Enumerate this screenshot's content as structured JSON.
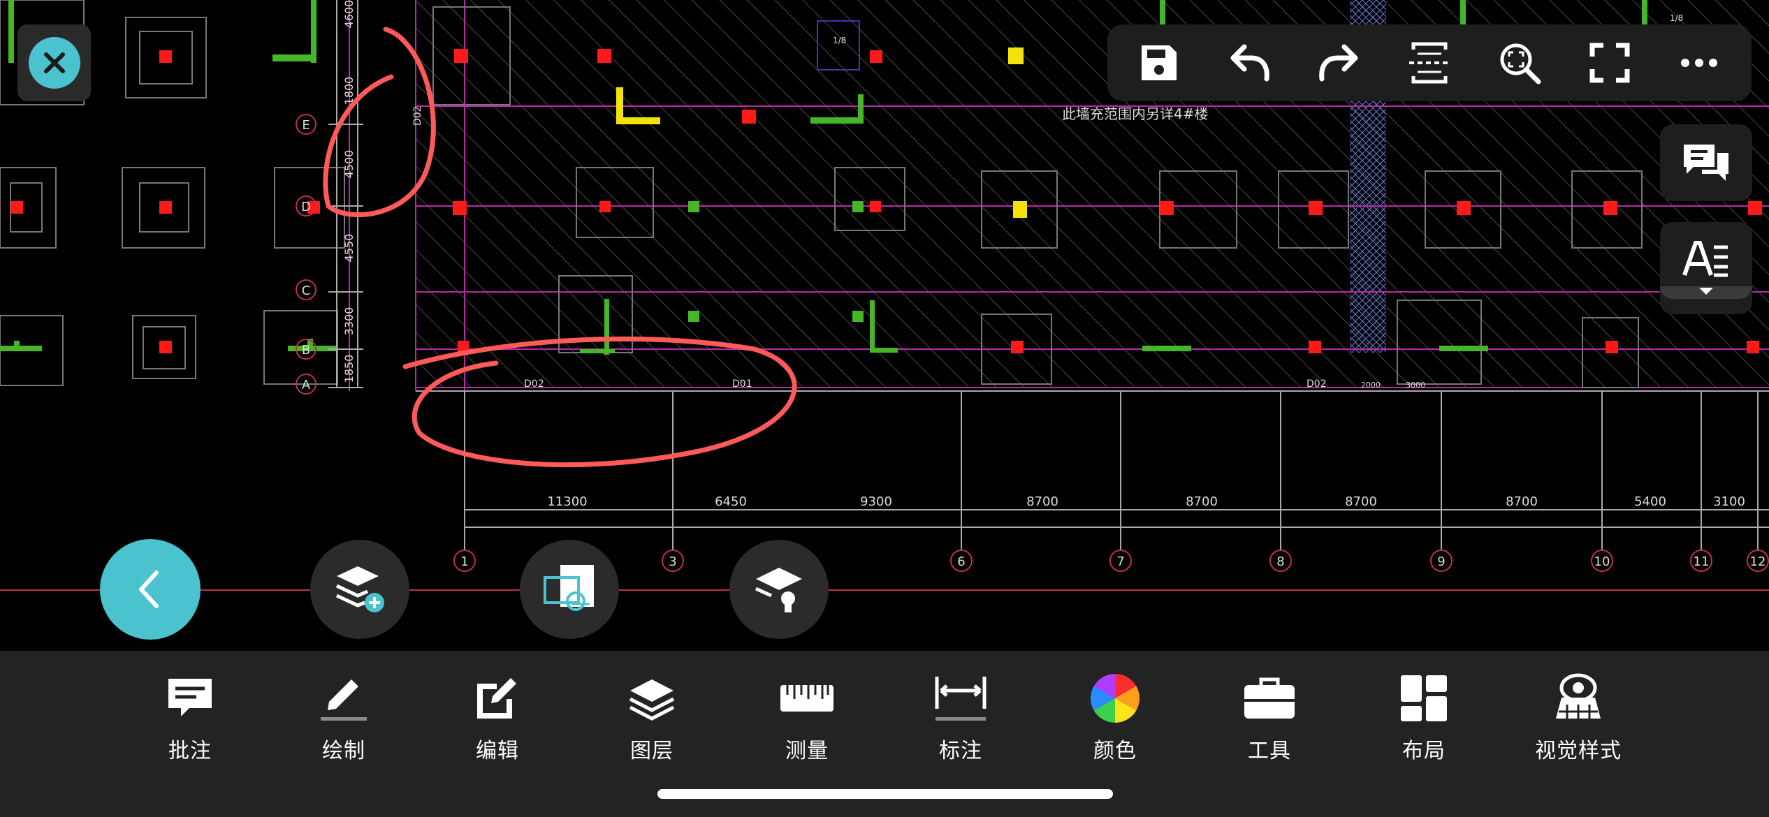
{
  "drawing": {
    "note_text": "此墙充范围内另详4#楼",
    "x_dimensions": [
      "11300",
      "6450",
      "9300",
      "8700",
      "8700",
      "8700",
      "8700",
      "5400",
      "3100"
    ],
    "grid_columns": [
      "1",
      "3",
      "6",
      "7",
      "8",
      "9",
      "10",
      "11",
      "12"
    ],
    "grid_rows": [
      "E",
      "D",
      "C",
      "B",
      "A"
    ],
    "y_dimensions": [
      "4600",
      "1800",
      "4500",
      "4550",
      "3300",
      "1850"
    ],
    "wall_tags": [
      "D02",
      "D02",
      "D01",
      "D02"
    ],
    "small_dims": [
      "2000",
      "3000"
    ],
    "tag_small": "1/8"
  },
  "toolbar": {
    "save_icon": "save-icon",
    "undo_icon": "undo-icon",
    "redo_icon": "redo-icon",
    "section_icon": "section-scan-icon",
    "zoom_icon": "zoom-extents-icon",
    "fullscreen_icon": "fullscreen-icon",
    "more_icon": "more-icon"
  },
  "bottom_bar": {
    "items": [
      {
        "label": "批注",
        "icon": "comment-icon"
      },
      {
        "label": "绘制",
        "icon": "pencil-icon"
      },
      {
        "label": "编辑",
        "icon": "edit-icon"
      },
      {
        "label": "图层",
        "icon": "layers-icon"
      },
      {
        "label": "测量",
        "icon": "ruler-icon"
      },
      {
        "label": "标注",
        "icon": "dimension-icon"
      },
      {
        "label": "颜色",
        "icon": "color-wheel-icon"
      },
      {
        "label": "工具",
        "icon": "toolbox-icon"
      },
      {
        "label": "布局",
        "icon": "layout-icon"
      },
      {
        "label": "视觉样式",
        "icon": "visual-style-icon"
      }
    ]
  },
  "colors": {
    "accent": "#4bc3cf",
    "annotation": "#ff5a5a",
    "panel": "#232323"
  }
}
